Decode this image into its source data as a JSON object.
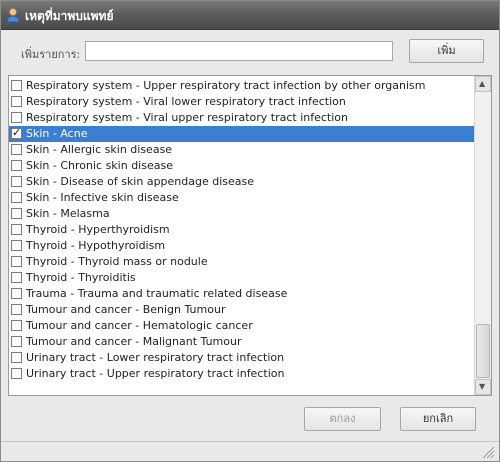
{
  "window": {
    "title": "เหตุที่มาพบแพทย์"
  },
  "add_form": {
    "label": "เพิ่มรายการ:",
    "input_value": "",
    "add_button_label": "เพิ่ม"
  },
  "list": {
    "items": [
      {
        "label": "Respiratory system - Upper respiratory tract infection by other organism",
        "checked": false,
        "selected": false
      },
      {
        "label": "Respiratory system - Viral lower respiratory tract infection",
        "checked": false,
        "selected": false
      },
      {
        "label": "Respiratory system - Viral upper respiratory tract infection",
        "checked": false,
        "selected": false
      },
      {
        "label": "Skin - Acne",
        "checked": true,
        "selected": true
      },
      {
        "label": "Skin - Allergic skin disease",
        "checked": false,
        "selected": false
      },
      {
        "label": "Skin - Chronic skin disease",
        "checked": false,
        "selected": false
      },
      {
        "label": "Skin - Disease of skin appendage disease",
        "checked": false,
        "selected": false
      },
      {
        "label": "Skin - Infective skin disease",
        "checked": false,
        "selected": false
      },
      {
        "label": "Skin - Melasma",
        "checked": false,
        "selected": false
      },
      {
        "label": "Thyroid - Hyperthyroidism",
        "checked": false,
        "selected": false
      },
      {
        "label": "Thyroid - Hypothyroidism",
        "checked": false,
        "selected": false
      },
      {
        "label": "Thyroid - Thyroid mass or nodule",
        "checked": false,
        "selected": false
      },
      {
        "label": "Thyroid - Thyroiditis",
        "checked": false,
        "selected": false
      },
      {
        "label": "Trauma - Trauma and traumatic related disease",
        "checked": false,
        "selected": false
      },
      {
        "label": "Tumour and cancer - Benign Tumour",
        "checked": false,
        "selected": false
      },
      {
        "label": "Tumour and cancer - Hematologic cancer",
        "checked": false,
        "selected": false
      },
      {
        "label": "Tumour and cancer - Malignant Tumour",
        "checked": false,
        "selected": false
      },
      {
        "label": "Urinary tract - Lower respiratory tract infection",
        "checked": false,
        "selected": false
      },
      {
        "label": "Urinary tract - Upper respiratory tract infection",
        "checked": false,
        "selected": false
      }
    ],
    "check_glyph": "✓"
  },
  "footer": {
    "ok_label": "ตกลง",
    "cancel_label": "ยกเลิก",
    "ok_enabled": false
  },
  "icons": {
    "app": "user-icon",
    "scroll_up": "arrow-up-icon",
    "scroll_down": "arrow-down-icon",
    "grip": "resize-grip-icon"
  },
  "colors": {
    "selection": "#3a7fd1",
    "titlebar": "#5a5a5a"
  }
}
